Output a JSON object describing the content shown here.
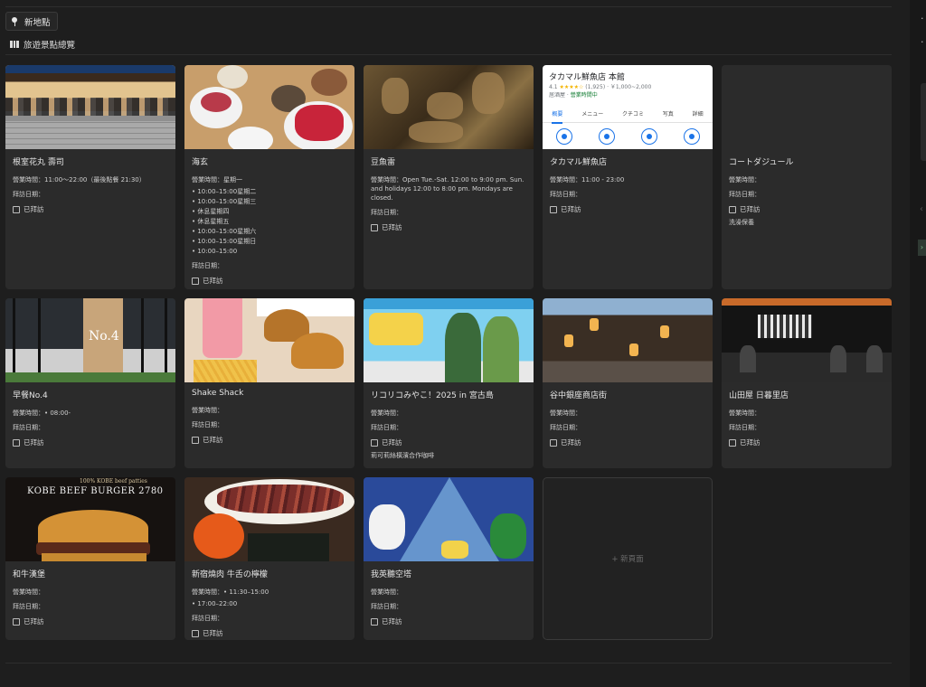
{
  "toolbar": {
    "add_label": "新地點"
  },
  "section": {
    "title": "旅遊景點總覽"
  },
  "labels": {
    "hours": "營業時間：",
    "visit_date": "拜訪日期：",
    "visited": "已拜訪"
  },
  "new_card": {
    "label": "+ 新頁面"
  },
  "maps_preview": {
    "title": "タカマル鮮魚店 本館",
    "rating": "4.1",
    "stars": "★★★★☆",
    "reviews": "(1,925)",
    "price": "· ￥1,000~2,000",
    "category": "居酒屋 ·",
    "status": "營業時間中",
    "tabs": [
      "概要",
      "メニュー",
      "クチコミ",
      "写真",
      "詳細"
    ]
  },
  "burger_image_text": {
    "title": "KOBE BEEF BURGER    2780",
    "subtitle": "100% KOBE beef patties"
  },
  "store_image_text": {
    "sign": "No.4"
  },
  "cards": [
    {
      "name": "根室花丸 壽司",
      "hours": "11:00～22:00（最後點餐 21:30）",
      "hours_list": [],
      "note": ""
    },
    {
      "name": "海玄",
      "hours": "星期一",
      "hours_list": [
        "• 10:00–15:00星期二",
        "• 10:00–15:00星期三",
        "• 休息星期四",
        "• 休息星期五",
        "• 10:00–15:00星期六",
        "• 10:00–15:00星期日",
        "• 10:00–15:00"
      ],
      "note": ""
    },
    {
      "name": "豆魚雷",
      "hours": "Open Tue.-Sat. 12:00 to 9:00 pm. Sun. and holidays 12:00 to 8:00 pm. Mondays are closed.",
      "hours_list": [],
      "note": ""
    },
    {
      "name": "タカマル鮮魚店",
      "hours": "11:00 - 23:00",
      "hours_list": [],
      "note": ""
    },
    {
      "name": "コートダジュール",
      "hours": "",
      "hours_list": [],
      "note": "洗澡保養"
    },
    {
      "name": "早餐No.4",
      "hours": "• 08:00-",
      "hours_list": [],
      "note": ""
    },
    {
      "name": "Shake Shack",
      "hours": "",
      "hours_list": [],
      "note": ""
    },
    {
      "name": "リコリコみやこ！2025 in 宮古島",
      "hours": "",
      "hours_list": [],
      "note": "莉可莉絲橫濱合作咖啡"
    },
    {
      "name": "谷中銀座商店街",
      "hours": "",
      "hours_list": [],
      "note": ""
    },
    {
      "name": "山田屋 日暮里店",
      "hours": "",
      "hours_list": [],
      "note": ""
    },
    {
      "name": "和牛漢堡",
      "hours": "",
      "hours_list": [],
      "note": ""
    },
    {
      "name": "新宿燒肉 牛舌の檸檬",
      "hours": "• 11:30–15:00",
      "hours_list": [
        "• 17:00–22:00"
      ],
      "note": ""
    },
    {
      "name": "我英聽空塔",
      "hours": "",
      "hours_list": [],
      "note": ""
    }
  ]
}
